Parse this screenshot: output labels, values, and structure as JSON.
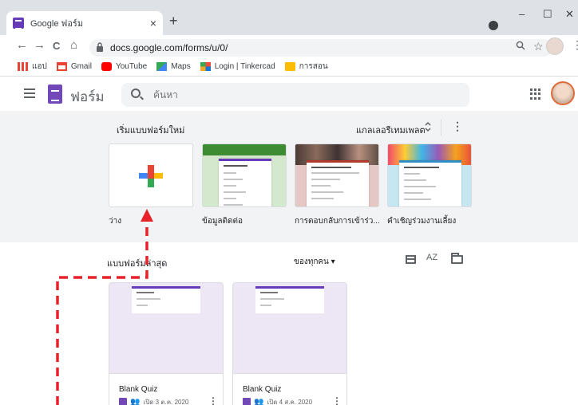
{
  "browser": {
    "tab_title": "Google ฟอร์ม",
    "tab_close": "×",
    "new_tab": "+",
    "win_min": "–",
    "win_max": "☐",
    "win_close": "✕",
    "url": "docs.google.com/forms/u/0/",
    "nav": {
      "back": "←",
      "forward": "→",
      "reload": "C",
      "home": "⌂"
    },
    "zoom_icon": "🔍",
    "star_icon": "☆",
    "menu_icon": "⋮",
    "bookmarks": [
      {
        "label": "แอป",
        "color": "#5f6368"
      },
      {
        "label": "Gmail",
        "color": "#ea4335"
      },
      {
        "label": "YouTube",
        "color": "#ff0000"
      },
      {
        "label": "Maps",
        "color": "#34a853"
      },
      {
        "label": "Login | Tinkercad",
        "color": "#1477d1"
      },
      {
        "label": "การสอน",
        "color": "#fbbc04"
      }
    ]
  },
  "header": {
    "app_name": "ฟอร์ม",
    "search_placeholder": "ค้นหา"
  },
  "gallery": {
    "title": "เริ่มแบบฟอร์มใหม่",
    "link": "แกลเลอรีเทมเพลต",
    "expand": "⌃⌄",
    "kebab": "⋮",
    "templates": [
      {
        "label": "ว่าง"
      },
      {
        "label": "ข้อมูลติดต่อ"
      },
      {
        "label": "การตอบกลับการเข้าร่ว..."
      },
      {
        "label": "คำเชิญร่วมงานเลี้ยง"
      }
    ]
  },
  "recent": {
    "title": "แบบฟอร์มล่าสุด",
    "owner_filter": "ของทุกคน ▾",
    "sort_icon": "AZ",
    "cards": [
      {
        "name": "Blank Quiz",
        "meta": "เปิด 3 ต.ค. 2020"
      },
      {
        "name": "Blank Quiz",
        "meta": "เปิด 4 ส.ค. 2020"
      }
    ],
    "shared_icon": "👥",
    "kebab": "⋮"
  },
  "colors": {
    "forms_purple": "#673ab7",
    "annotation_red": "#e8222a",
    "plus_red": "#ea4335",
    "plus_blue": "#4285f4",
    "plus_green": "#34a853",
    "plus_yellow": "#fbbc04"
  }
}
